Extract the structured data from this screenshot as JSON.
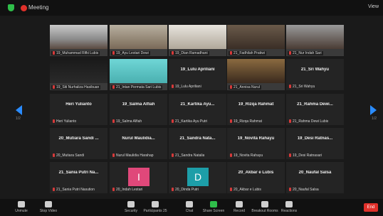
{
  "window": {
    "title": "Meeting",
    "view_label": "View"
  },
  "tiles": [
    {
      "name": "",
      "caption": "19_Muhammad Rifki Lubis"
    },
    {
      "name": "",
      "caption": "19_Ayu Lestari Dewi"
    },
    {
      "name": "",
      "caption": "19_Dian Ramadhani"
    },
    {
      "name": "",
      "caption": "21_Fadhilah Pratiwi"
    },
    {
      "name": "",
      "caption": "21_Nur Indah Sari"
    },
    {
      "name": "",
      "caption": "19_Siti Nurhaliza Hasibuan"
    },
    {
      "name": "",
      "caption": "21_Intan Permata Sari Lubis"
    },
    {
      "name": "19_Lulu Apriliani",
      "caption": "19_Lulu Apriliani"
    },
    {
      "name": "",
      "caption": "21_Annisa Nurul"
    },
    {
      "name": "21_Sri Wahyu",
      "caption": "21_Sri Wahyu"
    },
    {
      "name": "Heri Yulianto",
      "caption": "Heri Yulianto"
    },
    {
      "name": "19_Salma Alfiah",
      "caption": "19_Salma Alfiah"
    },
    {
      "name": "21_Kartika Ayu...",
      "caption": "21_Kartika Ayu Putri"
    },
    {
      "name": "19_Rizqa Rahmat",
      "caption": "19_Rizqa Rahmat"
    },
    {
      "name": "21_Rahma Dewi...",
      "caption": "21_Rahma Dewi Lubis"
    },
    {
      "name": "20_Mutiara Sandi ...",
      "caption": "20_Mutiara Sandi"
    },
    {
      "name": "Nurul Maulidia...",
      "caption": "Nurul Maulidia Harahap"
    },
    {
      "name": "21_Sandra Nata...",
      "caption": "21_Sandra Natalia"
    },
    {
      "name": "19_Novita Rahayu",
      "caption": "19_Novita Rahayu"
    },
    {
      "name": "19_Desi Ratnas...",
      "caption": "19_Desi Ratnasari"
    },
    {
      "name": "21_Sania Putri Na...",
      "caption": "21_Sania Putri Nasution"
    },
    {
      "name": "",
      "caption": "20_Indah Lestari",
      "avatar": "I",
      "avatar_color": "#e0487a"
    },
    {
      "name": "",
      "caption": "20_Dinda Putri",
      "avatar": "D",
      "avatar_color": "#1d9ea8"
    },
    {
      "name": "20_Akbar e Lubis",
      "caption": "20_Akbar e Lubis"
    },
    {
      "name": "20_Naufal Salsa",
      "caption": "20_Naufal Salsa"
    }
  ],
  "pager": {
    "left": "1/2",
    "right": "1/2"
  },
  "toolbar": {
    "unmute": "Unmute",
    "stop_video": "Stop Video",
    "security": "Security",
    "participants": "Participants",
    "participants_count": "25",
    "chat": "Chat",
    "share_screen": "Share Screen",
    "record": "Record",
    "breakout_rooms": "Breakout Rooms",
    "reactions": "Reactions",
    "end": "End"
  },
  "colors": {
    "accent": "#2a8cff",
    "end": "#e0302a",
    "share": "#2fbe4a"
  }
}
